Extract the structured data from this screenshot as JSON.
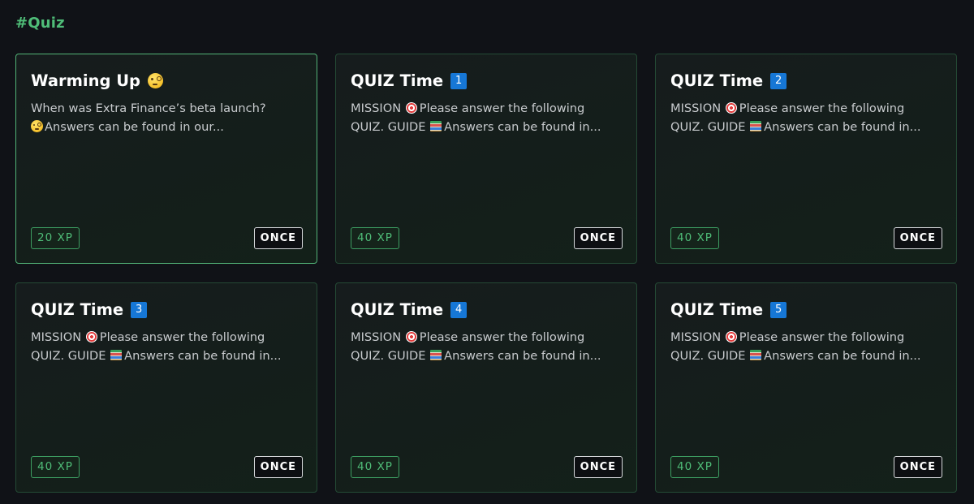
{
  "section": {
    "title": "#Quiz"
  },
  "cards": [
    {
      "title": "Warming Up",
      "title_icon": "monocle-face-emoji",
      "desc_line1": "When was Extra Finance’s beta launch?",
      "desc_line2": "Answers can be found in our...",
      "xp": "20 XP",
      "frequency": "ONCE"
    },
    {
      "title": "QUIZ Time",
      "badge": "1",
      "desc_mission": "MISSION",
      "desc_line1_rest": "Please answer the following",
      "desc_guide": "QUIZ. GUIDE",
      "desc_line2_rest": "Answers can be found in...",
      "xp": "40 XP",
      "frequency": "ONCE"
    },
    {
      "title": "QUIZ Time",
      "badge": "2",
      "desc_mission": "MISSION",
      "desc_line1_rest": "Please answer the following",
      "desc_guide": "QUIZ. GUIDE",
      "desc_line2_rest": "Answers can be found in...",
      "xp": "40 XP",
      "frequency": "ONCE"
    },
    {
      "title": "QUIZ Time",
      "badge": "3",
      "desc_mission": "MISSION",
      "desc_line1_rest": "Please answer the following",
      "desc_guide": "QUIZ. GUIDE",
      "desc_line2_rest": "Answers can be found in...",
      "xp": "40 XP",
      "frequency": "ONCE"
    },
    {
      "title": "QUIZ Time",
      "badge": "4",
      "desc_mission": "MISSION",
      "desc_line1_rest": "Please answer the following",
      "desc_guide": "QUIZ. GUIDE",
      "desc_line2_rest": "Answers can be found in...",
      "xp": "40 XP",
      "frequency": "ONCE"
    },
    {
      "title": "QUIZ Time",
      "badge": "5",
      "desc_mission": "MISSION",
      "desc_line1_rest": "Please answer the following",
      "desc_guide": "QUIZ. GUIDE",
      "desc_line2_rest": "Answers can be found in...",
      "xp": "40 XP",
      "frequency": "ONCE"
    }
  ],
  "icons": {
    "mission": "direct-hit-target-emoji",
    "guide": "books-emoji"
  },
  "colors": {
    "background": "#101217",
    "accent_green": "#4fbd78",
    "card_border": "#244a35",
    "card_border_active": "#52b377",
    "number_badge": "#1677d6"
  }
}
